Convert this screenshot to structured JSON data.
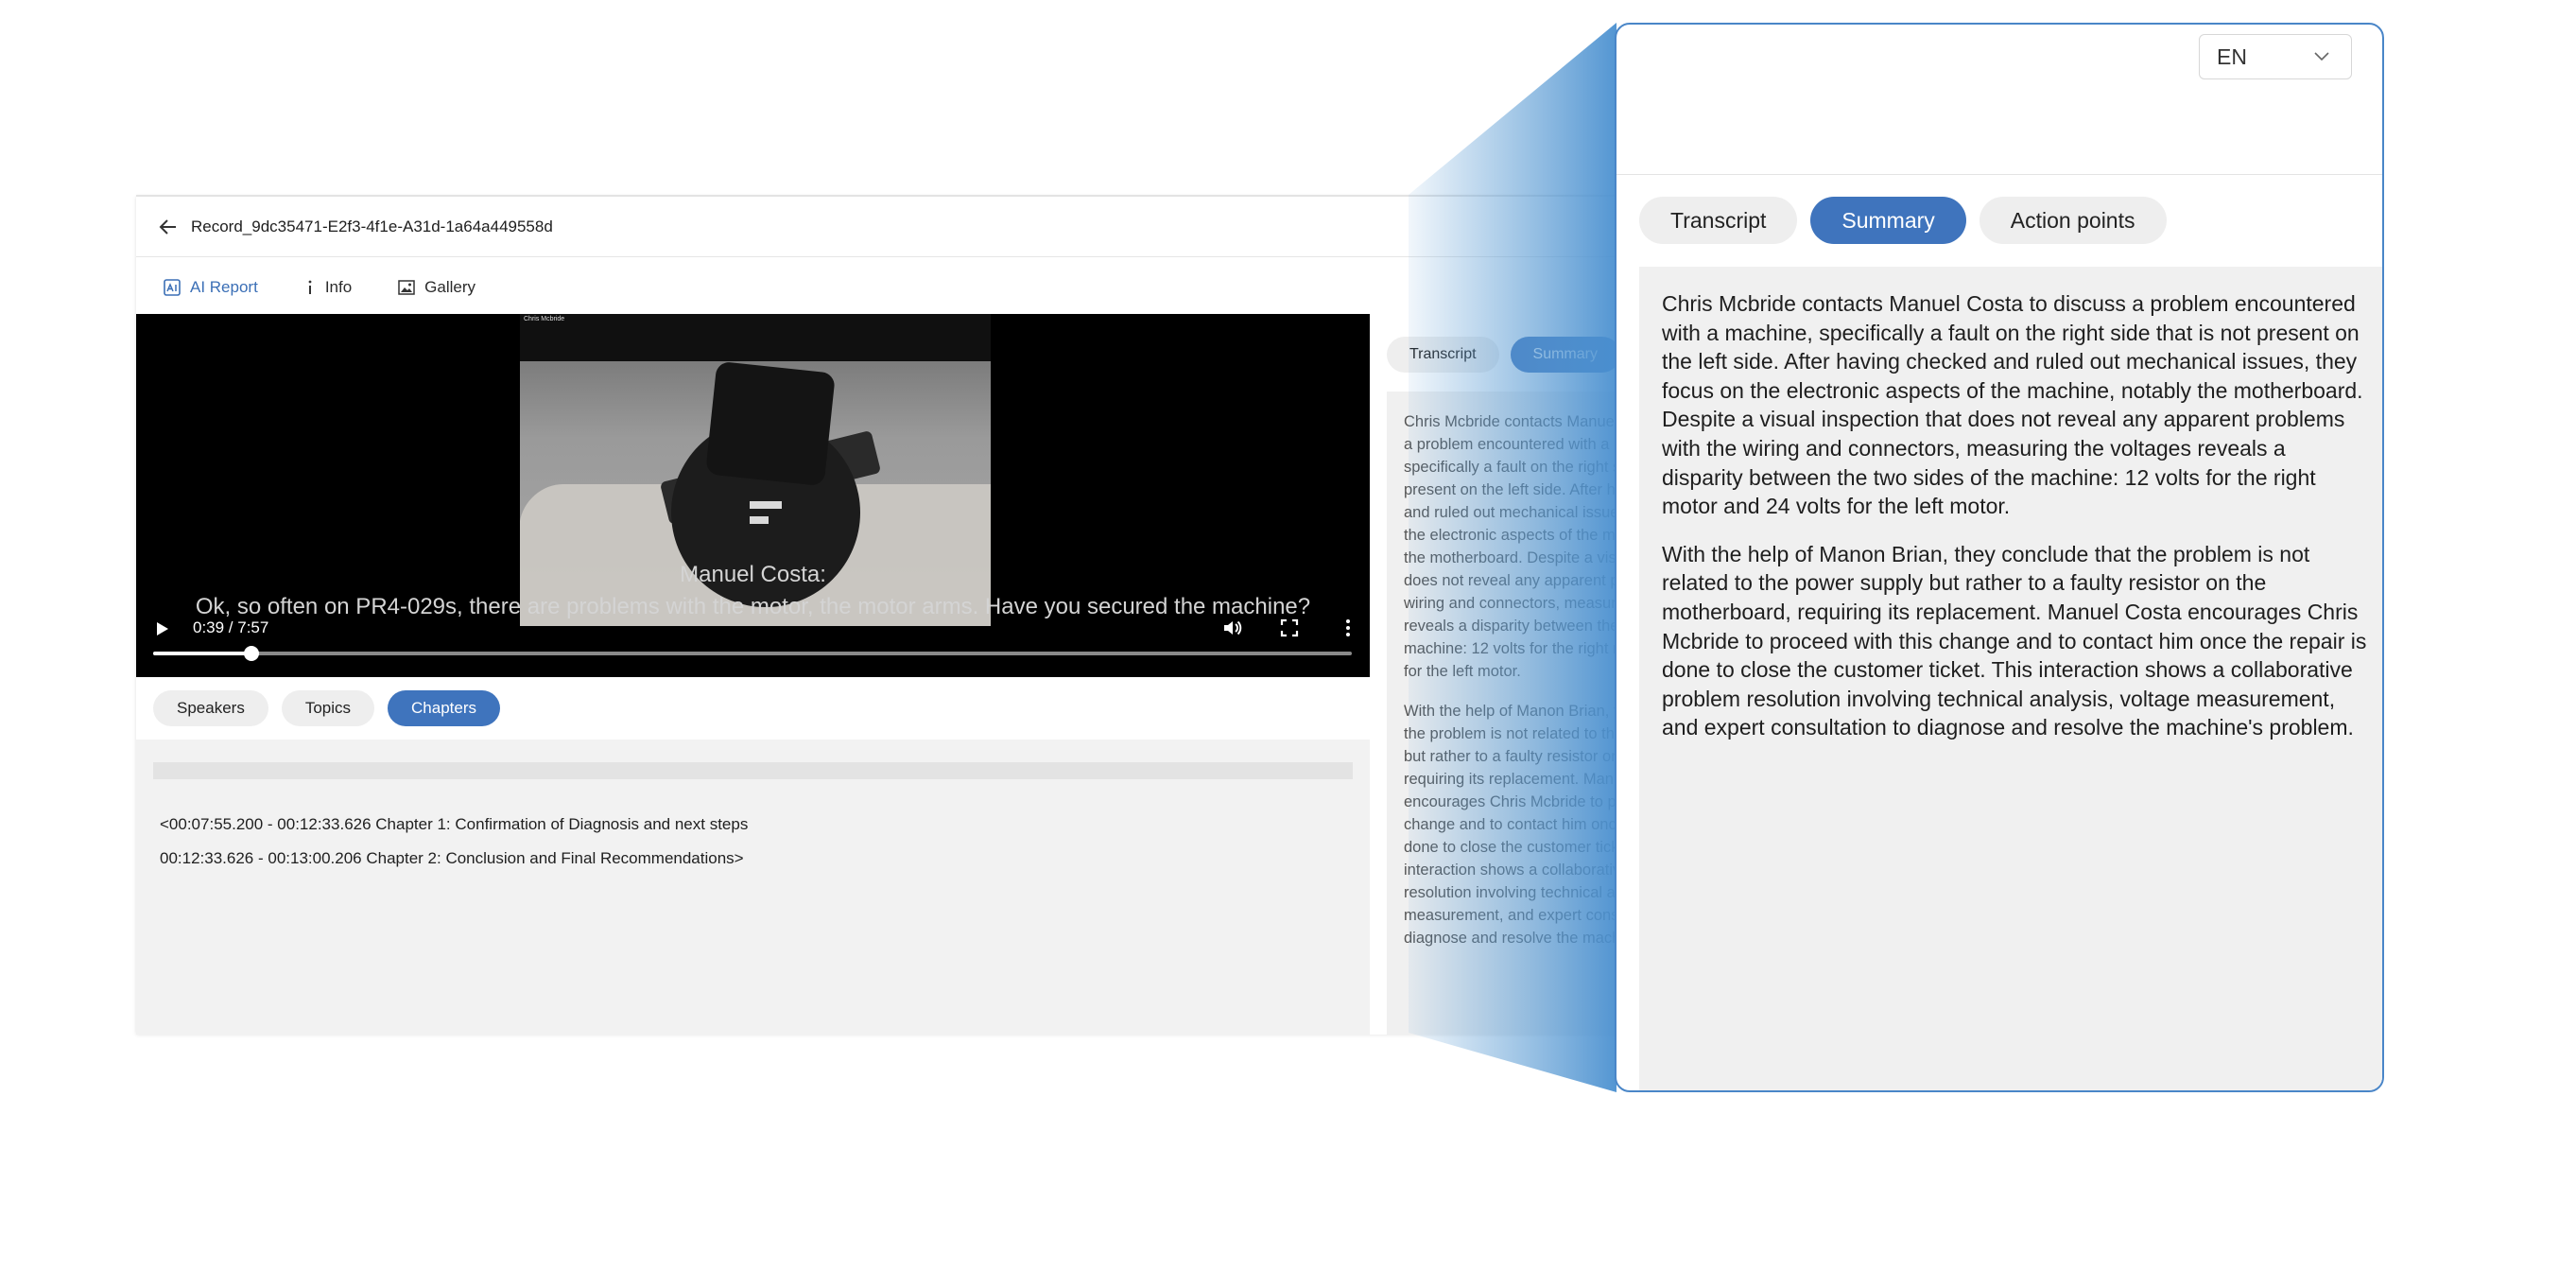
{
  "record": {
    "title": "Record_9dc35471-E2f3-4f1e-A31d-1a64a449558d"
  },
  "nav": {
    "tabs": [
      {
        "label": "AI Report",
        "icon": "ai-report-icon",
        "active": true
      },
      {
        "label": "Info",
        "icon": "info-icon",
        "active": false
      },
      {
        "label": "Gallery",
        "icon": "gallery-icon",
        "active": false
      }
    ]
  },
  "video": {
    "camera_label": "Chris Mcbride",
    "caption_speaker": "Manuel Costa:",
    "caption_text": "Ok, so often on PR4-029s, there are problems with the motor, the motor arms. Have you secured the machine?",
    "time": "0:39 / 7:57",
    "progress": 0.0817
  },
  "lower_tabs": [
    {
      "label": "Speakers",
      "active": false
    },
    {
      "label": "Topics",
      "active": false
    },
    {
      "label": "Chapters",
      "active": true
    }
  ],
  "chapters": [
    "<00:07:55.200 - 00:12:33.626 Chapter 1: Confirmation of Diagnosis and next steps",
    "00:12:33.626 - 00:13:00.206 Chapter 2: Conclusion and Final Recommendations>"
  ],
  "summary_tabs": [
    {
      "label": "Transcript",
      "active": false
    },
    {
      "label": "Summary",
      "active": true
    },
    {
      "label": "Action points",
      "active": false
    }
  ],
  "language": "EN",
  "summary": {
    "p1": "Chris Mcbride contacts Manuel Costa to discuss a problem encountered with a machine, specifically a fault on the right side that is not present on the left side. After having checked and ruled out mechanical issues, they focus on the electronic aspects of the machine, notably the motherboard. Despite a visual inspection that does not reveal any apparent problems with the wiring and connectors, measuring the voltages reveals a disparity between the two sides of the machine: 12 volts for the right motor and 24 volts for the left motor.",
    "p2": "With the help of Manon Brian, they conclude that the problem is not related to the power supply but rather to a faulty resistor on the motherboard, requiring its replacement. Manuel Costa encourages Chris Mcbride to proceed with this change and to contact him once the repair is done to close the customer ticket. This interaction shows a collaborative problem resolution involving technical analysis, voltage measurement, and expert consultation to diagnose and resolve the machine's problem."
  },
  "colors": {
    "accent": "#3f74bd",
    "panel_border": "#4a86c8",
    "beam": "#5a9bd3"
  }
}
